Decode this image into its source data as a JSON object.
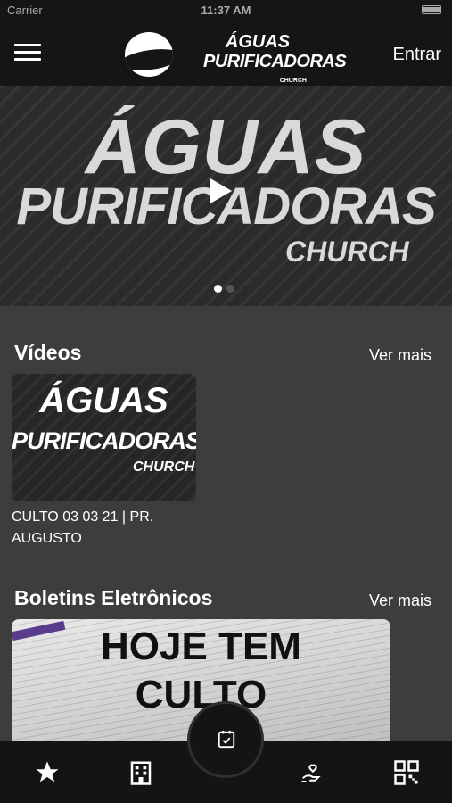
{
  "status": {
    "carrier": "Carrier",
    "time": "11:37 AM"
  },
  "header": {
    "logo_line1": "ÁGUAS",
    "logo_line2": "PURIFICADORAS",
    "logo_line3": "CHURCH",
    "login_label": "Entrar"
  },
  "hero": {
    "line1": "ÁGUAS",
    "line2": "PURIFICADORAS",
    "line3": "CHURCH",
    "slides": 2,
    "active_slide": 1
  },
  "videos": {
    "title": "Vídeos",
    "see_more": "Ver mais",
    "items": [
      {
        "thumb_line1": "ÁGUAS",
        "thumb_line2": "PURIFICADORAS",
        "thumb_line3": "CHURCH",
        "title": "CULTO 03 03 21 | PR. AUGUSTO"
      }
    ]
  },
  "bulletins": {
    "title": "Boletins Eletrônicos",
    "see_more": "Ver mais",
    "items": [
      {
        "line1": "HOJE TEM",
        "line2": "CULTO"
      }
    ]
  },
  "tabbar": {
    "icons": [
      "star-icon",
      "building-icon",
      "calendar-check-icon",
      "hand-heart-icon",
      "qr-code-icon"
    ]
  },
  "colors": {
    "background": "#3d3d3d",
    "bar": "#151515",
    "text": "#ffffff"
  }
}
